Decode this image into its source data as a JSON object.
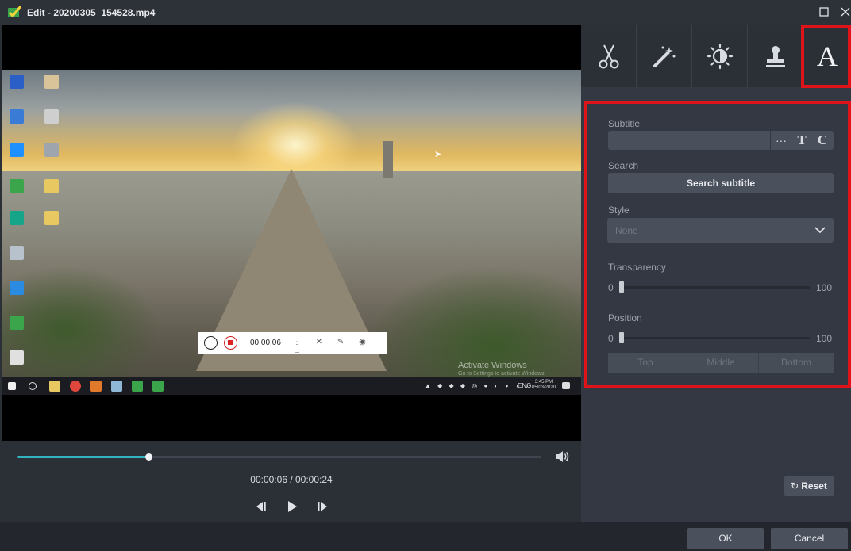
{
  "window": {
    "title": "Edit - 20200305_154528.mp4"
  },
  "video": {
    "recorder_time": "00.00.06",
    "watermark_line1": "Activate Windows",
    "watermark_line2": "Go to Settings to activate Windows.",
    "clock_time": "3:45 PM",
    "clock_date": "05/03/2020",
    "systray_lang": "ENG"
  },
  "player": {
    "time_display": "00:00:06 / 00:00:24",
    "progress_fraction": 0.25,
    "accent_color": "#33b3c0"
  },
  "tabs": [
    {
      "icon": "scissors-icon",
      "name": "Cut"
    },
    {
      "icon": "magic-wand-icon",
      "name": "Effects"
    },
    {
      "icon": "brightness-icon",
      "name": "Adjust"
    },
    {
      "icon": "stamp-icon",
      "name": "Watermark"
    },
    {
      "icon": "text-A-icon",
      "glyph": "A",
      "name": "Subtitle",
      "active": true
    }
  ],
  "subtitle_panel": {
    "subtitle_label": "Subtitle",
    "subtitle_value": "",
    "more_glyph": "···",
    "font_glyph": "T",
    "color_glyph": "C",
    "search_label": "Search",
    "search_button": "Search subtitle",
    "style_label": "Style",
    "style_value": "None",
    "transparency_label": "Transparency",
    "transparency_min": "0",
    "transparency_max": "100",
    "transparency_value": 0,
    "position_label": "Position",
    "position_min": "0",
    "position_max": "100",
    "position_value": 0,
    "position_buttons": [
      "Top",
      "Middle",
      "Bottom"
    ],
    "reset_button": "Reset"
  },
  "footer": {
    "ok_label": "OK",
    "cancel_label": "Cancel"
  },
  "highlight_color": "#e0121a"
}
